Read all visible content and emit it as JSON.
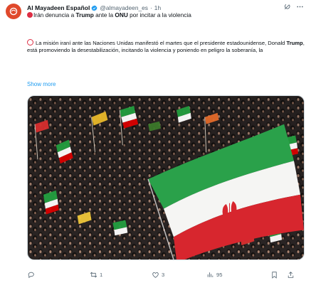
{
  "tweet": {
    "author_name": "Al Mayadeen Español",
    "handle": "@almayadeen_es",
    "separator": "·",
    "time": "1h",
    "headline": {
      "part1": "Irán denuncia a ",
      "bold": "Trump",
      "part2": " ante la ",
      "bold2": "ONU",
      "part3": " por incitar a la violencia"
    },
    "body": {
      "part1": "La misión iraní ante las Naciones Unidas manifestó el martes que el presidente estadounidense, Donald ",
      "bold": "Trump",
      "part2": ", está promoviendo la desestabilización, incitando la violencia y poniendo en peligro la soberanía, la"
    },
    "show_more": "Show more",
    "stats": {
      "replies": "",
      "retweets": "1",
      "likes": "3",
      "views": "95"
    }
  },
  "icons": {
    "avatar": "al-mayadeen-logo",
    "verified": "verified-badge-icon",
    "grok": "grok-icon",
    "more": "more-icon",
    "reply": "reply-icon",
    "retweet": "retweet-icon",
    "like": "heart-icon",
    "views": "views-icon",
    "bookmark": "bookmark-icon",
    "share": "share-icon"
  },
  "colors": {
    "accent": "#1d9bf0",
    "brand": "#e0492b",
    "emoji_red": "#dd2e44",
    "muted": "#536471"
  }
}
